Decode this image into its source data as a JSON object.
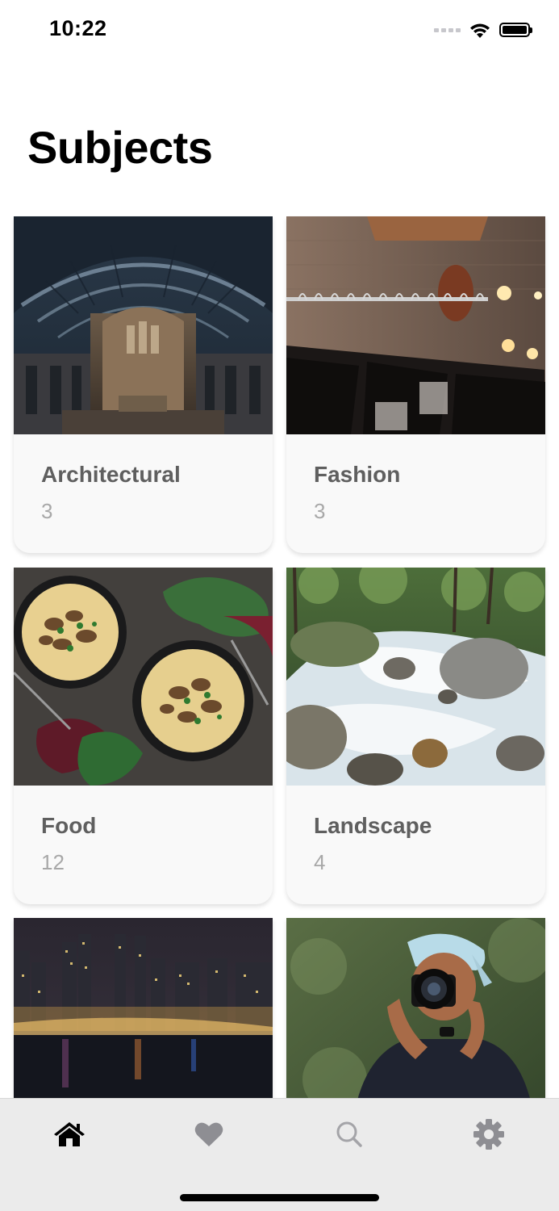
{
  "status_bar": {
    "time": "10:22"
  },
  "page": {
    "title": "Subjects"
  },
  "subjects": [
    {
      "name": "Architectural",
      "count": "3",
      "image": "architecture-hall-photo"
    },
    {
      "name": "Fashion",
      "count": "3",
      "image": "clothing-rack-photo"
    },
    {
      "name": "Food",
      "count": "12",
      "image": "mushroom-polenta-bowls-photo"
    },
    {
      "name": "Landscape",
      "count": "4",
      "image": "forest-stream-photo"
    },
    {
      "name": "",
      "count": "",
      "image": "city-skyline-night-photo"
    },
    {
      "name": "",
      "count": "",
      "image": "photographer-with-camera-photo"
    }
  ],
  "tab_bar": {
    "tabs": [
      {
        "icon": "home-icon",
        "active": true
      },
      {
        "icon": "heart-icon",
        "active": false
      },
      {
        "icon": "search-icon",
        "active": false
      },
      {
        "icon": "gear-icon",
        "active": false
      }
    ]
  },
  "colors": {
    "active_tab": "#000000",
    "inactive_tab": "#8e8e93",
    "card_background": "#f9f9f9",
    "title_text": "#5f5f5f",
    "count_text": "#a8a8a8"
  }
}
